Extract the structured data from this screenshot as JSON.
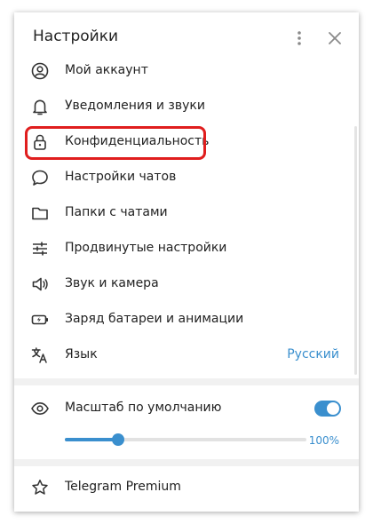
{
  "header": {
    "title": "Настройки",
    "menu_icon": "vertical-dots-icon",
    "close_icon": "close-icon"
  },
  "items": [
    {
      "label": "Мой аккаунт",
      "icon": "account-circle-icon"
    },
    {
      "label": "Уведомления и звуки",
      "icon": "bell-icon"
    },
    {
      "label": "Конфиденциальность",
      "icon": "lock-icon"
    },
    {
      "label": "Настройки чатов",
      "icon": "chat-bubble-icon"
    },
    {
      "label": "Папки с чатами",
      "icon": "folder-icon"
    },
    {
      "label": "Продвинутые настройки",
      "icon": "sliders-icon"
    },
    {
      "label": "Звук и камера",
      "icon": "speaker-icon"
    },
    {
      "label": "Заряд батареи и анимации",
      "icon": "battery-icon"
    },
    {
      "label": "Язык",
      "icon": "translate-icon",
      "value": "Русский"
    }
  ],
  "scale": {
    "label": "Масштаб по умолчанию",
    "icon": "eye-icon",
    "toggle_on": true,
    "slider_fraction": 0.22,
    "value_text": "100%"
  },
  "premium": {
    "label": "Telegram Premium",
    "icon": "star-icon"
  },
  "colors": {
    "accent": "#3a8fce",
    "highlight": "#e01e1e",
    "text": "#222222",
    "separator": "#f1f1f1"
  }
}
